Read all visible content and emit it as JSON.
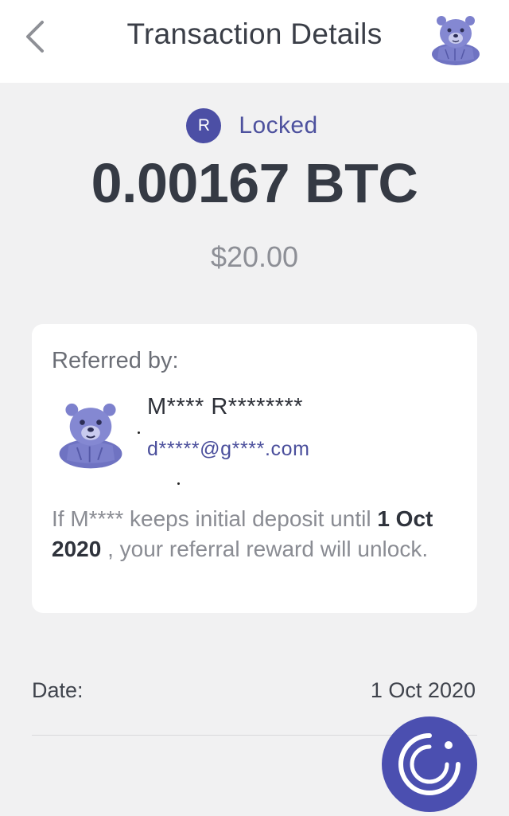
{
  "header": {
    "title": "Transaction Details",
    "back_icon": "chevron-left-icon",
    "avatar_icon": "bear-avatar-icon"
  },
  "status": {
    "badge_letter": "R",
    "label": "Locked",
    "badge_color": "#4c4fa5"
  },
  "amount": {
    "btc": "0.00167 BTC",
    "usd": "$20.00"
  },
  "referral_card": {
    "label": "Referred by:",
    "name": "M**** R********",
    "email": "d*****@g****.com",
    "avatar_icon": "bear-avatar-icon",
    "note_before": "If M**** keeps initial deposit until ",
    "note_date": "1 Oct 2020",
    "note_after": " , your referral reward will unlock."
  },
  "details": {
    "date_label": "Date:",
    "date_value": "1 Oct 2020"
  },
  "fab": {
    "icon": "support-chat-icon"
  },
  "colors": {
    "accent": "#4c4fa5",
    "background": "#f1f1f2",
    "card": "#ffffff"
  }
}
